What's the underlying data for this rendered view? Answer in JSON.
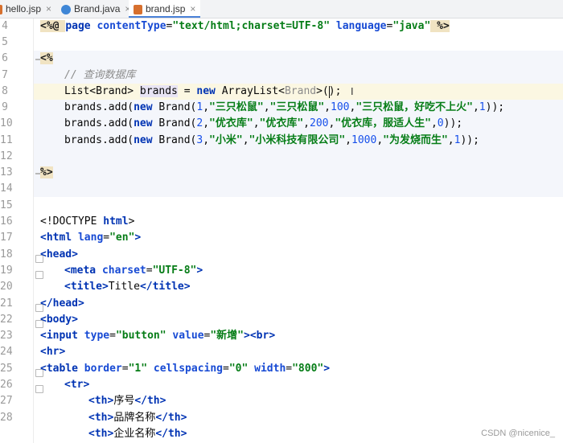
{
  "tabs": [
    {
      "label": "hello.jsp",
      "icon": "jsp-file-icon",
      "active": false
    },
    {
      "label": "Brand.java",
      "icon": "java-class-icon",
      "active": false
    },
    {
      "label": "brand.jsp",
      "icon": "jsp-file-icon",
      "active": true
    }
  ],
  "tab_close": "×",
  "line_numbers": [
    "4",
    "5",
    "6",
    "7",
    "8",
    "9",
    "10",
    "11",
    "12",
    "13",
    "14",
    "15",
    "16",
    "17",
    "18",
    "19",
    "20",
    "21",
    "22",
    "23",
    "24",
    "25",
    "26",
    "27",
    "28"
  ],
  "code": {
    "l4": {
      "a": "<%@ ",
      "b": "page ",
      "c": "contentType",
      "d": "=",
      "e": "\"text/html;charset=UTF-8\"",
      "f": " language",
      "g": "=",
      "h": "\"java\"",
      "i": " %>"
    },
    "l6": "<%",
    "l7": "// 查询数据库",
    "l8": {
      "a": "List<Brand> ",
      "b": "brands",
      "c": " = ",
      "d": "new ",
      "e": "ArrayList<",
      "f": "Brand",
      "g": ">();"
    },
    "l9": {
      "a": "brands.add(",
      "b": "new ",
      "c": "Brand(",
      "d": "1",
      "e": ",",
      "f": "\"三只松鼠\"",
      "g": ",",
      "h": "\"三只松鼠\"",
      "i": ",",
      "j": "100",
      "k": ",",
      "l": "\"三只松鼠，好吃不上火\"",
      "m": ",",
      "n": "1",
      "o": "));"
    },
    "l10": {
      "a": "brands.add(",
      "b": "new ",
      "c": "Brand(",
      "d": "2",
      "e": ",",
      "f": "\"优衣库\"",
      "g": ",",
      "h": "\"优衣库\"",
      "i": ",",
      "j": "200",
      "k": ",",
      "l": "\"优衣库，服适人生\"",
      "m": ",",
      "n": "0",
      "o": "));"
    },
    "l11": {
      "a": "brands.add(",
      "b": "new ",
      "c": "Brand(",
      "d": "3",
      "e": ",",
      "f": "\"小米\"",
      "g": ",",
      "h": "\"小米科技有限公司\"",
      "i": ",",
      "j": "1000",
      "k": ",",
      "l": "\"为发烧而生\"",
      "m": ",",
      "n": "1",
      "o": "));"
    },
    "l13": "%>",
    "l16": {
      "a": "<!DOCTYPE ",
      "b": "html",
      "c": ">"
    },
    "l17": {
      "a": "<html ",
      "b": "lang",
      "c": "=",
      "d": "\"en\"",
      "e": ">"
    },
    "l18": "<head>",
    "l19": {
      "a": "<meta ",
      "b": "charset",
      "c": "=",
      "d": "\"UTF-8\"",
      "e": ">"
    },
    "l20": {
      "a": "<title>",
      "b": "Title",
      "c": "</title>"
    },
    "l21": "</head>",
    "l22": "<body>",
    "l23": {
      "a": "<input ",
      "b": "type",
      "c": "=",
      "d": "\"button\"",
      "e": " value",
      "f": "=",
      "g": "\"新增\"",
      "h": "><br>"
    },
    "l24": "<hr>",
    "l25": {
      "a": "<table ",
      "b": "border",
      "c": "=",
      "d": "\"1\"",
      "e": " cellspacing",
      "f": "=",
      "g": "\"0\"",
      "h": " width",
      "i": "=",
      "j": "\"800\"",
      "k": ">"
    },
    "l26": "<tr>",
    "l27": {
      "a": "<th>",
      "b": "序号",
      "c": "</th>"
    },
    "l28": {
      "a": "<th>",
      "b": "品牌名称",
      "c": "</th>"
    },
    "l29": {
      "a": "<th>",
      "b": "企业名称",
      "c": "</th>"
    }
  },
  "cursor_glyph": "I",
  "watermark": "CSDN @nicenice_"
}
